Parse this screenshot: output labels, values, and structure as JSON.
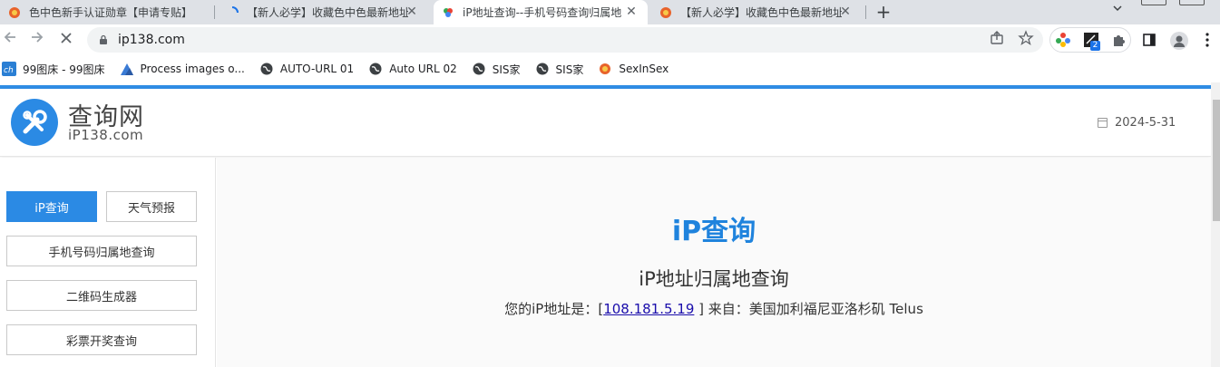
{
  "tabs": [
    {
      "title": "色中色新手认证勋章【申请专贴】",
      "icon": "flower-favicon"
    },
    {
      "title": "【新人必学】收藏色中色最新地址",
      "icon": "loading-favicon"
    },
    {
      "title": "iP地址查询--手机号码查询归属地",
      "icon": "colorful-favicon",
      "active": true
    },
    {
      "title": "【新人必学】收藏色中色最新地址",
      "icon": "flower-favicon"
    }
  ],
  "toolbar": {
    "url": "ip138.com",
    "extension_badge": "2"
  },
  "bookmarks": [
    {
      "label": "99图床 - 99图床",
      "icon": "ch-icon"
    },
    {
      "label": "Process images o...",
      "icon": "mountain-icon"
    },
    {
      "label": "AUTO-URL 01",
      "icon": "globe-icon"
    },
    {
      "label": "Auto URL 02",
      "icon": "globe-icon"
    },
    {
      "label": "SIS家",
      "icon": "globe-icon"
    },
    {
      "label": "SIS家",
      "icon": "globe-icon"
    },
    {
      "label": "SexInSex",
      "icon": "flower-icon"
    }
  ],
  "header": {
    "site_name": "查询网",
    "site_domain": "iP138.com",
    "date": "2024-5-31"
  },
  "sidebar": {
    "ip_query": "iP查询",
    "weather": "天气预报",
    "phone_lookup": "手机号码归属地查询",
    "qr_code": "二维码生成器",
    "lottery": "彩票开奖查询"
  },
  "main": {
    "title": "iP查询",
    "subtitle": "iP地址归属地查询",
    "ip_prefix": "您的iP地址是：[",
    "ip_address": "108.181.5.19",
    "ip_suffix": " ] 来自：美国加利福尼亚洛杉矶 Telus"
  },
  "colors": {
    "accent": "#2b8ae4",
    "link": "#1a0dab"
  }
}
